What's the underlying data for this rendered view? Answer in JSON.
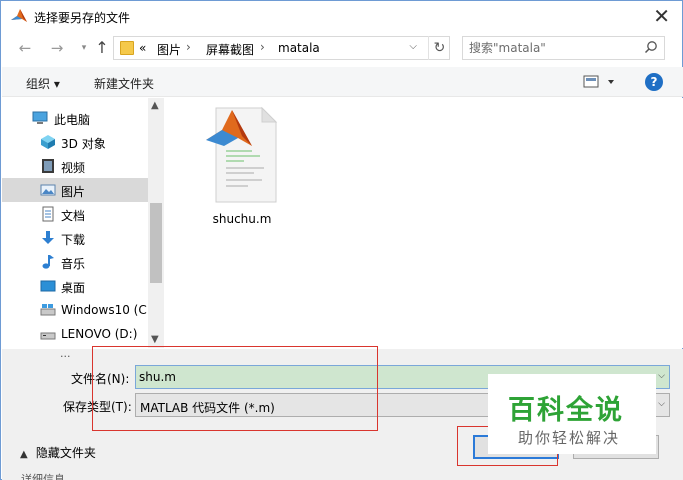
{
  "window": {
    "title": "选择要另存的文件"
  },
  "address_bar": {
    "overflow": "«",
    "crumbs": [
      "图片",
      "屏幕截图",
      "matala"
    ],
    "separator": "›"
  },
  "search": {
    "placeholder": "搜索\"matala\""
  },
  "toolbar": {
    "organize_label": "组织 ▾",
    "new_folder_label": "新建文件夹",
    "help_label": "?"
  },
  "nav_pane": {
    "items": [
      {
        "label": "此电脑",
        "icon": "computer-icon"
      },
      {
        "label": "3D 对象",
        "icon": "3d-objects-icon"
      },
      {
        "label": "视频",
        "icon": "video-icon"
      },
      {
        "label": "图片",
        "icon": "pictures-icon",
        "selected": true
      },
      {
        "label": "文档",
        "icon": "documents-icon"
      },
      {
        "label": "下载",
        "icon": "downloads-icon"
      },
      {
        "label": "音乐",
        "icon": "music-icon"
      },
      {
        "label": "桌面",
        "icon": "desktop-icon"
      },
      {
        "label": "Windows10 (C:",
        "icon": "drive-c-icon"
      },
      {
        "label": "LENOVO (D:)",
        "icon": "drive-d-icon"
      }
    ],
    "partial_item": "..."
  },
  "content": {
    "files": [
      {
        "name": "shuchu.m",
        "icon": "matlab-file-icon"
      }
    ]
  },
  "form": {
    "filename_label": "文件名(N):",
    "filename_value": "shu.m",
    "filetype_label": "保存类型(T):",
    "filetype_value": "MATLAB 代码文件 (*.m)"
  },
  "footer": {
    "hide_folders_label": "隐藏文件夹",
    "cutoff_text": "详细信息"
  },
  "watermark": {
    "title": "百科全说",
    "subtitle": "助你轻松解决"
  },
  "colors": {
    "accent": "#1f6fc5",
    "selection": "#d9d9d9",
    "filename_bg": "#cfe6cf",
    "annotation_red": "#d9352e",
    "watermark_green": "#2ea336"
  }
}
